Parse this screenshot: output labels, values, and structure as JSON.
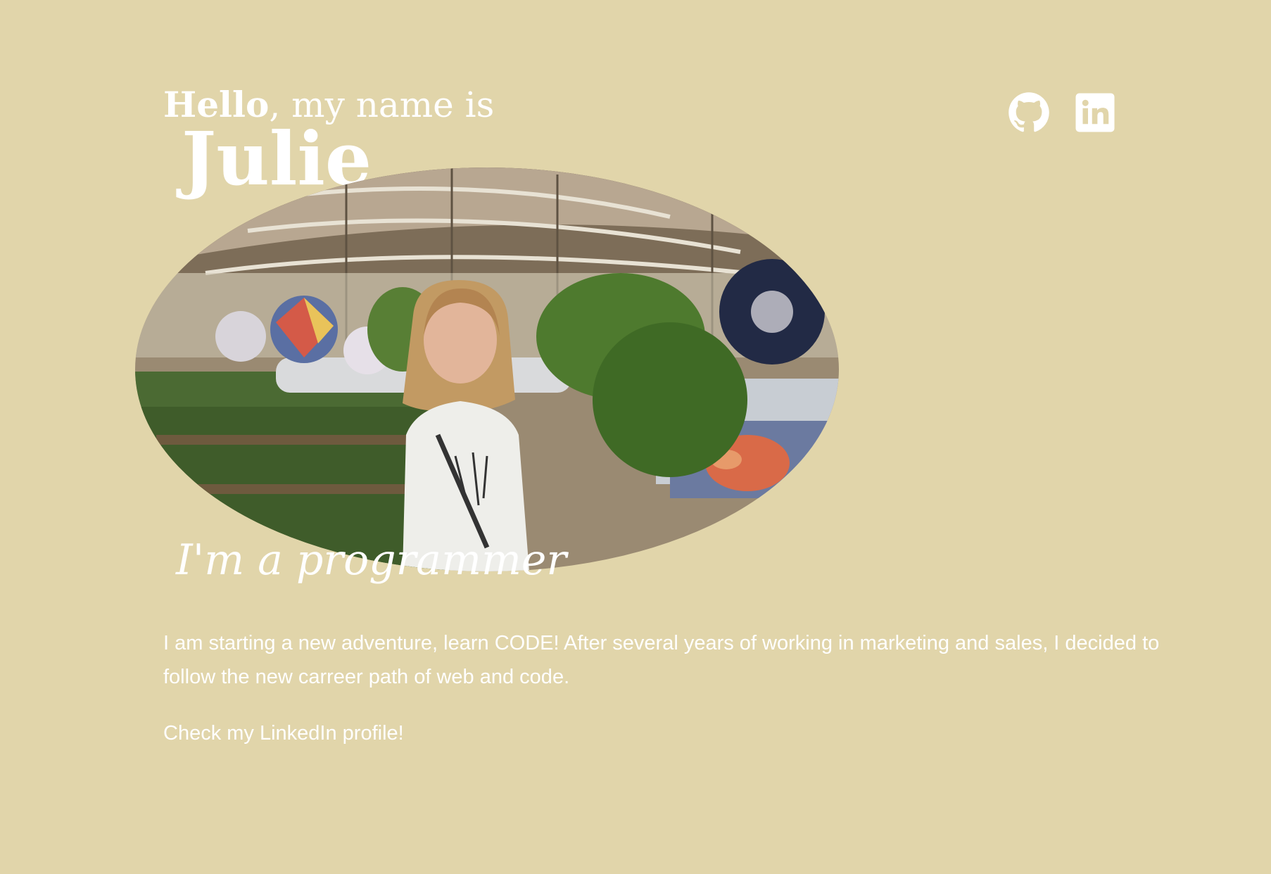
{
  "header": {
    "greeting_bold": "Hello",
    "greeting_rest": ", my name is",
    "name": "Julie"
  },
  "socials": [
    {
      "icon": "github-icon",
      "label": "GitHub"
    },
    {
      "icon": "linkedin-icon",
      "label": "LinkedIn"
    }
  ],
  "hero": {
    "tagline": "I'm a programmer"
  },
  "about": {
    "bio": "I am starting a new adventure, learn CODE! After several years of working in marketing and sales, I decided to follow the new carreer path of web and code.",
    "cta": "Check my LinkedIn profile!"
  },
  "colors": {
    "background": "#e1d5aa",
    "text": "#ffffff"
  }
}
